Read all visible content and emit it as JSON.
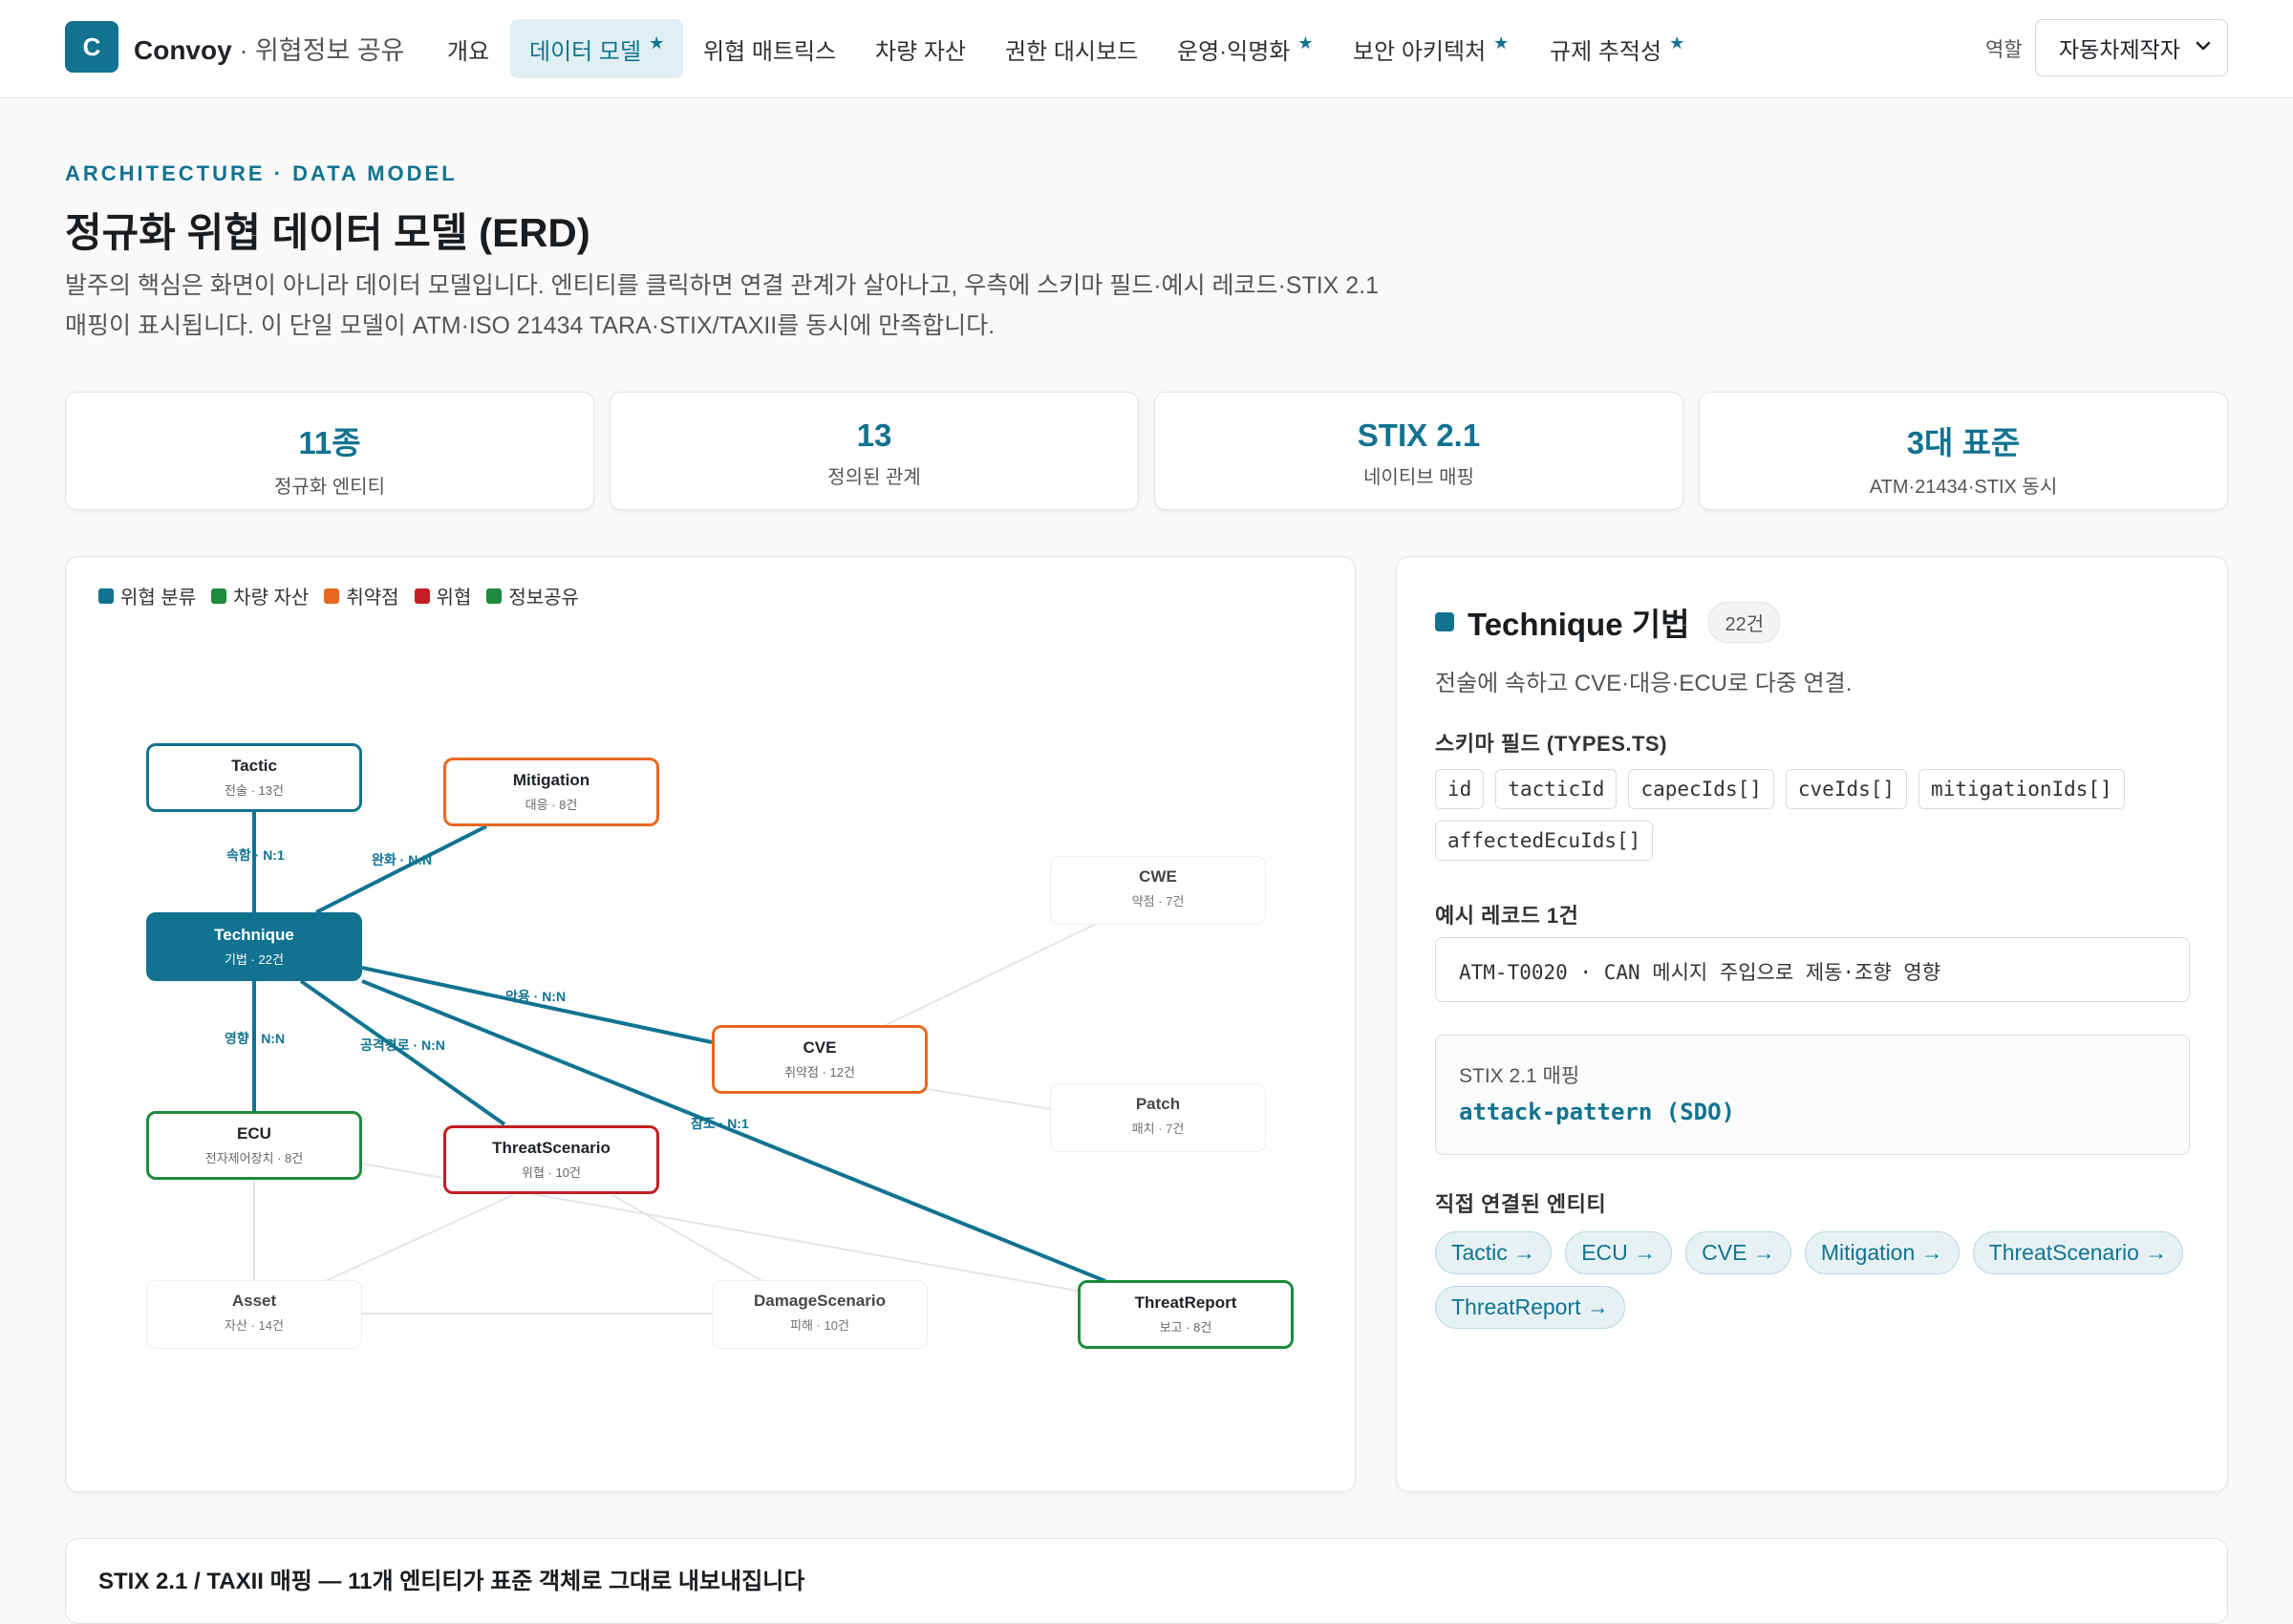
{
  "brand": {
    "logo_letter": "C",
    "name": "Convoy",
    "subtitle": "· 위협정보 공유"
  },
  "nav": [
    {
      "label": "개요",
      "star": ""
    },
    {
      "label": "데이터 모델",
      "star": "★"
    },
    {
      "label": "위협 매트릭스",
      "star": ""
    },
    {
      "label": "차량 자산",
      "star": ""
    },
    {
      "label": "권한 대시보드",
      "star": ""
    },
    {
      "label": "운영·익명화",
      "star": "★"
    },
    {
      "label": "보안 아키텍처",
      "star": "★"
    },
    {
      "label": "규제 추적성",
      "star": "★"
    }
  ],
  "role": {
    "label": "역할",
    "value": "자동차제작자"
  },
  "header": {
    "eyebrow": "ARCHITECTURE · DATA MODEL",
    "title": "정규화 위협 데이터 모델 (ERD)",
    "description": "발주의 핵심은 화면이 아니라 데이터 모델입니다. 엔티티를 클릭하면 연결 관계가 살아나고, 우측에 스키마 필드·예시 레코드·STIX 2.1 매핑이 표시됩니다. 이 단일 모델이 ATM·ISO 21434 TARA·STIX/TAXII를 동시에 만족합니다."
  },
  "stats": [
    {
      "value": "11종",
      "label": "정규화 엔티티"
    },
    {
      "value": "13",
      "label": "정의된 관계"
    },
    {
      "value": "STIX 2.1",
      "label": "네이티브 매핑"
    },
    {
      "value": "3대 표준",
      "label": "ATM·21434·STIX 동시"
    }
  ],
  "legend": [
    {
      "label": "위협 분류",
      "color": "#117390"
    },
    {
      "label": "차량 자산",
      "color": "#1e8a3e"
    },
    {
      "label": "취약점",
      "color": "#e8681f"
    },
    {
      "label": "위협",
      "color": "#c41e24"
    },
    {
      "label": "정보공유",
      "color": "#1e8a3e"
    }
  ],
  "nodes": [
    {
      "name": "Tactic",
      "count": "전술 · 13건"
    },
    {
      "name": "Mitigation",
      "count": "대응 · 8건"
    },
    {
      "name": "CWE",
      "count": "약점 · 7건"
    },
    {
      "name": "Technique",
      "count": "기법 · 22건"
    },
    {
      "name": "CVE",
      "count": "취약점 · 12건"
    },
    {
      "name": "Patch",
      "count": "패치 · 7건"
    },
    {
      "name": "ECU",
      "count": "전자제어장치 · 8건"
    },
    {
      "name": "ThreatScenario",
      "count": "위협 · 10건"
    },
    {
      "name": "Asset",
      "count": "자산 · 14건"
    },
    {
      "name": "DamageScenario",
      "count": "피해 · 10건"
    },
    {
      "name": "ThreatReport",
      "count": "보고 · 8건"
    }
  ],
  "edge_labels": [
    "속함 · N:1",
    "완화 · N:N",
    "악용 · N:N",
    "영향 · N:N",
    "공격경로 · N:N",
    "참조 · N:1"
  ],
  "detail": {
    "title": "Technique 기법",
    "count": "22건",
    "description": "전술에 속하고 CVE·대응·ECU로 다중 연결.",
    "fields_title": "스키마 필드 (TYPES.TS)",
    "fields": [
      "id",
      "tacticId",
      "capecIds[]",
      "cveIds[]",
      "mitigationIds[]",
      "affectedEcuIds[]"
    ],
    "record_title": "예시 레코드 1건",
    "record": "ATM-T0020 · CAN 메시지 주입으로 제동·조향 영향",
    "stix_label": "STIX 2.1 매핑",
    "stix_value": "attack-pattern (SDO)",
    "links_title": "직접 연결된 엔티티",
    "links": [
      "Tactic →",
      "ECU →",
      "CVE →",
      "Mitigation →",
      "ThreatScenario →",
      "ThreatReport →"
    ]
  },
  "bottom": {
    "title": "STIX 2.1 / TAXII 매핑 — 11개 엔티티가 표준 객체로 그대로 내보내집니다"
  }
}
